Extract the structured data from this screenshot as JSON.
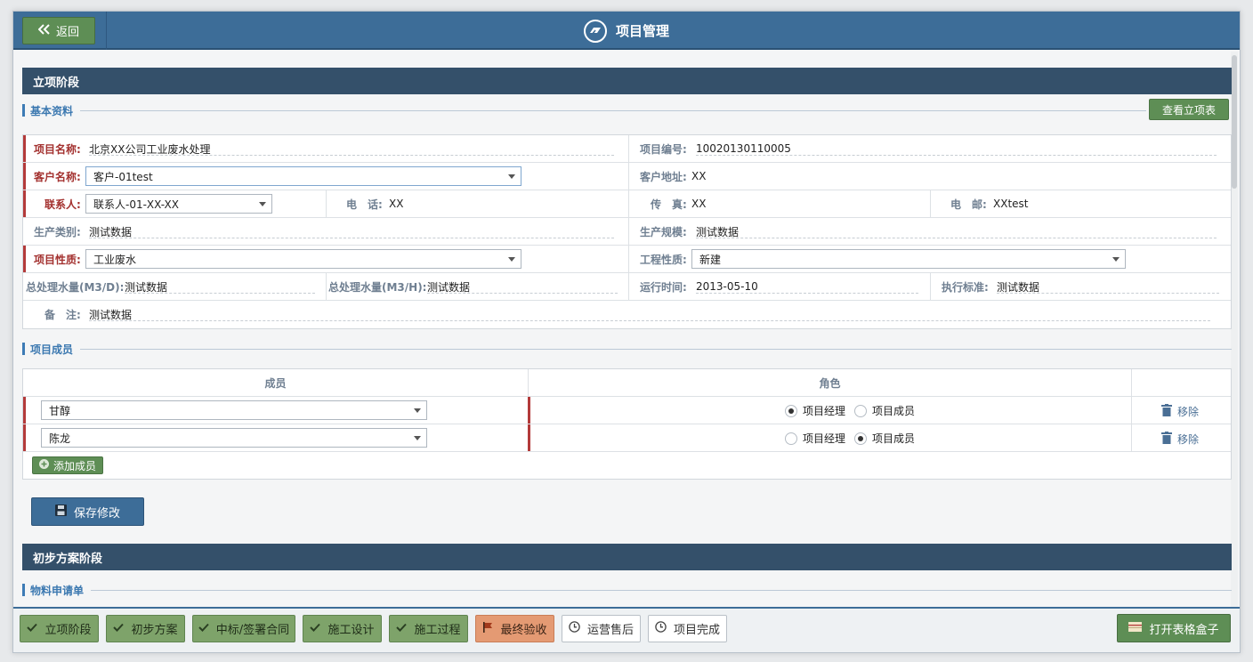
{
  "header": {
    "back_label": "返回",
    "title": "项目管理"
  },
  "stage1": {
    "title": "立项阶段",
    "basic_section": "基本资料",
    "view_button": "查看立项表",
    "fields": {
      "project_name_label": "项目名称:",
      "project_name": "北京XX公司工业废水处理",
      "project_no_label": "项目编号:",
      "project_no": "10020130110005",
      "customer_label": "客户名称:",
      "customer": "客户-01test",
      "address_label": "客户地址:",
      "address": "XX",
      "contact_label": "联系人:",
      "contact": "联系人-01-XX-XX",
      "phone_label": "电　话:",
      "phone": "XX",
      "fax_label": "传　真:",
      "fax": "XX",
      "email_label": "电　邮:",
      "email": "XXtest",
      "prod_type_label": "生产类别:",
      "prod_type": "测试数据",
      "prod_scale_label": "生产规模:",
      "prod_scale": "测试数据",
      "nature_label": "项目性质:",
      "nature": "工业废水",
      "eng_nature_label": "工程性质:",
      "eng_nature": "新建",
      "water_d_label": "总处理水量(M3/D):",
      "water_d": "测试数据",
      "water_h_label": "总处理水量(M3/H):",
      "water_h": "测试数据",
      "run_time_label": "运行时间:",
      "run_time": "2013-05-10",
      "standard_label": "执行标准:",
      "standard": "测试数据",
      "remark_label": "备　注:",
      "remark": "测试数据"
    },
    "members_section": "项目成员",
    "members_table": {
      "col_member": "成员",
      "col_role": "角色",
      "role_manager": "项目经理",
      "role_member": "项目成员",
      "remove_label": "移除",
      "rows": [
        {
          "name": "甘醇",
          "role": "manager"
        },
        {
          "name": "陈龙",
          "role": "member"
        }
      ],
      "add_label": "添加成员"
    },
    "save_label": "保存修改"
  },
  "stage2": {
    "title": "初步方案阶段",
    "section": "物料申请单"
  },
  "steps": [
    {
      "label": "立项阶段",
      "state": "done"
    },
    {
      "label": "初步方案",
      "state": "done"
    },
    {
      "label": "中标/签署合同",
      "state": "done"
    },
    {
      "label": "施工设计",
      "state": "done"
    },
    {
      "label": "施工过程",
      "state": "done"
    },
    {
      "label": "最终验收",
      "state": "current"
    },
    {
      "label": "运营售后",
      "state": "todo"
    },
    {
      "label": "项目完成",
      "state": "todo"
    }
  ],
  "open_box_label": "打开表格盒子",
  "colors": {
    "primary": "#3d6d98",
    "success": "#5e8e55",
    "stage": "#34506a",
    "current": "#e49a73",
    "required": "#b33a3a"
  }
}
